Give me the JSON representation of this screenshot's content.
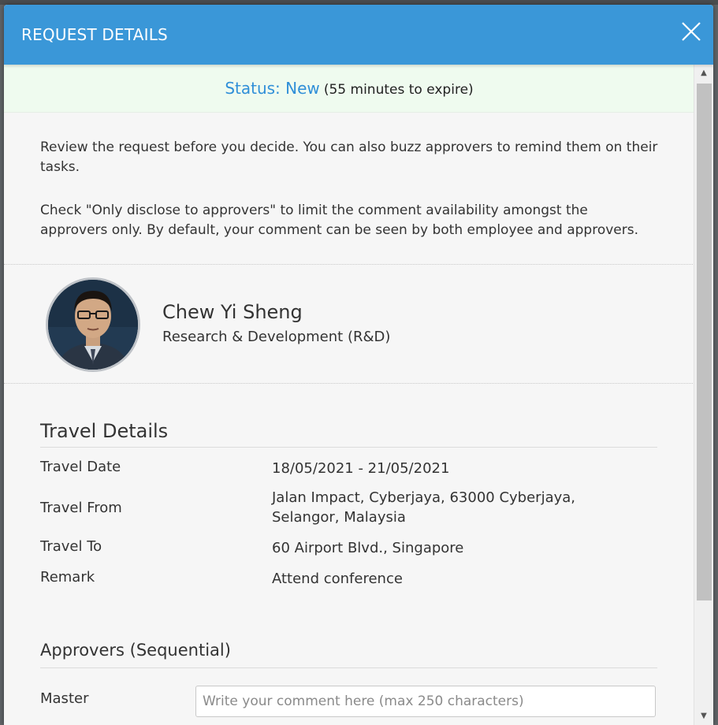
{
  "modal": {
    "title": "REQUEST DETAILS",
    "close_icon": "close-icon"
  },
  "status": {
    "label": "Status: New",
    "expire": "(55 minutes to expire)",
    "label_color": "#2f8fd8"
  },
  "intro": {
    "paragraph1": "Review the request before you decide. You can also buzz approvers to remind them on their tasks.",
    "paragraph2": "Check \"Only disclose to approvers\" to limit the comment availability amongst the approvers only. By default, your comment can be seen by both employee and approvers."
  },
  "employee": {
    "name": "Chew Yi Sheng",
    "department": "Research & Development (R&D)",
    "avatar_icon": "avatar"
  },
  "travel": {
    "title": "Travel Details",
    "rows": [
      {
        "label": "Travel Date",
        "value": "18/05/2021 - 21/05/2021"
      },
      {
        "label": "Travel From",
        "value": "Jalan Impact, Cyberjaya, 63000 Cyberjaya, Selangor, Malaysia"
      },
      {
        "label": "Travel To",
        "value": "60 Airport Blvd., Singapore"
      },
      {
        "label": "Remark",
        "value": "Attend conference"
      }
    ]
  },
  "approvers": {
    "title": "Approvers (Sequential)",
    "items": [
      {
        "name": "Master",
        "comment_placeholder": "Write your comment here (max 250 characters)"
      }
    ]
  },
  "colors": {
    "header": "#3a97d8",
    "status_background": "#effbef"
  }
}
